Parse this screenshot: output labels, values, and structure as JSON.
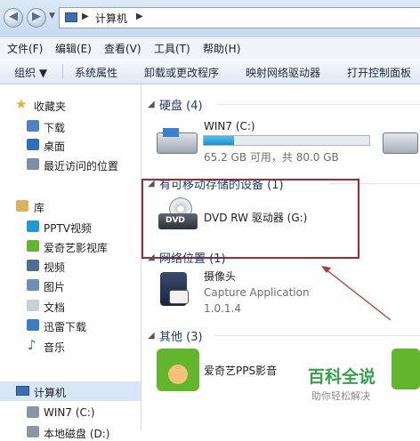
{
  "address": {
    "path": "计算机"
  },
  "menubar": [
    "文件(F)",
    "编辑(E)",
    "查看(V)",
    "工具(T)",
    "帮助(H)"
  ],
  "toolbar": [
    "组织 ▼",
    "系统属性",
    "卸载或更改程序",
    "映射网络驱动器",
    "打开控制面板"
  ],
  "nav": {
    "favorites": "收藏夹",
    "fav_items": [
      "下载",
      "桌面",
      "最近访问的位置"
    ],
    "libraries": "库",
    "lib_items": [
      "PPTV视频",
      "爱奇艺影视库",
      "视频",
      "图片",
      "文档",
      "迅雷下载",
      "音乐"
    ],
    "computer": "计算机",
    "comp_items": [
      "WIN7 (C:)",
      "本地磁盘 (D:)"
    ]
  },
  "groups": {
    "hdd": "硬盘 (4)",
    "removable": "有可移动存储的设备 (1)",
    "network": "网络位置 (1)",
    "other": "其他 (3)"
  },
  "drive_c": {
    "name": "WIN7 (C:)",
    "free": "65.2 GB 可用，共 80.0 GB",
    "used_fraction": 0.185
  },
  "dvd": {
    "name": "DVD RW 驱动器 (G:)",
    "badge": "DVD"
  },
  "camera": {
    "name": "摄像头",
    "desc": "Capture Application",
    "version": "1.0.1.4"
  },
  "other": {
    "name": "爱奇艺PPS影音"
  },
  "watermark": {
    "title": "百科全说",
    "subtitle": "助你轻松解决"
  },
  "colors": {
    "highlight_box": "#a02a2f",
    "arrow": "#b03a3a",
    "progress": "#27a4dc",
    "iqiyi_green": "#63b52b"
  }
}
